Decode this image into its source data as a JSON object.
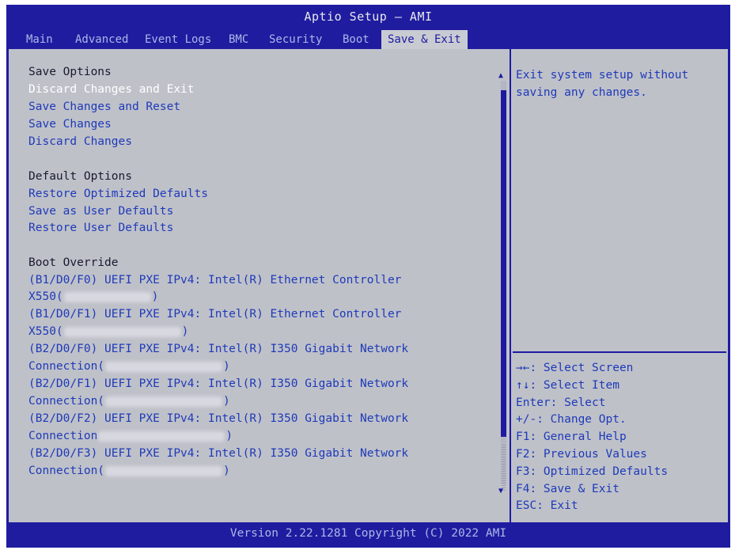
{
  "window": {
    "title": "Aptio Setup – AMI",
    "footer": "Version 2.22.1281 Copyright (C) 2022 AMI"
  },
  "tabs": [
    {
      "label": "Main"
    },
    {
      "label": "Advanced"
    },
    {
      "label": "Event Logs"
    },
    {
      "label": "BMC"
    },
    {
      "label": "Security"
    },
    {
      "label": "Boot"
    },
    {
      "label": "Save & Exit",
      "active": true
    }
  ],
  "menu": {
    "save_options_header": "Save Options",
    "save_options": [
      "Discard Changes and Exit",
      "Save Changes and Reset",
      "Save Changes",
      "Discard Changes"
    ],
    "default_options_header": "Default Options",
    "default_options": [
      "Restore Optimized Defaults",
      "Save as User Defaults",
      "Restore User Defaults"
    ],
    "boot_override_header": "Boot Override",
    "boot_override": [
      {
        "line1": "(B1/D0/F0) UEFI PXE IPv4: Intel(R) Ethernet Controller",
        "line2": "X550("
      },
      {
        "line1": "(B1/D0/F1) UEFI PXE IPv4: Intel(R) Ethernet Controller",
        "line2": "X550("
      },
      {
        "line1": "(B2/D0/F0) UEFI PXE IPv4: Intel(R) I350 Gigabit Network",
        "line2": "Connection("
      },
      {
        "line1": "(B2/D0/F1) UEFI PXE IPv4: Intel(R) I350 Gigabit Network",
        "line2": "Connection("
      },
      {
        "line1": "(B2/D0/F2) UEFI PXE IPv4: Intel(R) I350 Gigabit Network",
        "line2": "Connection"
      },
      {
        "line1": "(B2/D0/F3) UEFI PXE IPv4: Intel(R) I350 Gigabit Network",
        "line2": "Connection("
      }
    ],
    "close_paren": ")",
    "selected_item": "Discard Changes and Exit"
  },
  "help": {
    "description": "Exit system setup without\nsaving any changes.",
    "keys": [
      "→←: Select Screen",
      "↑↓: Select Item",
      "Enter: Select",
      "+/-: Change Opt.",
      "F1: General Help",
      "F2: Previous Values",
      "F3: Optimized Defaults",
      "F4: Save & Exit",
      "ESC: Exit"
    ]
  },
  "icons": {
    "scroll_up": "scroll-up-arrow-icon",
    "scroll_down": "scroll-down-arrow-icon"
  },
  "colors": {
    "frame_blue": "#1f1ca0",
    "panel_gray": "#bfc1c9",
    "item_blue": "#1e3ab8",
    "selected_white": "#ffffff"
  }
}
